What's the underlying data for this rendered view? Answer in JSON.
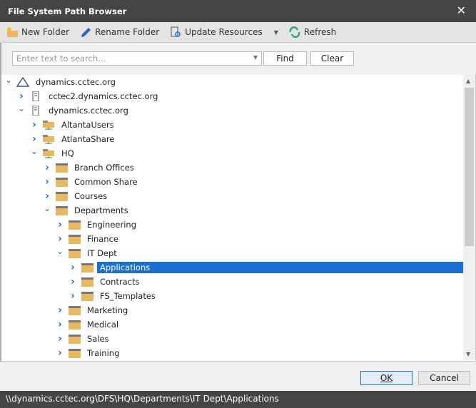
{
  "window": {
    "title": "File System Path Browser"
  },
  "toolbar": {
    "new_folder": "New Folder",
    "rename_folder": "Rename Folder",
    "update_resources": "Update Resources",
    "refresh": "Refresh"
  },
  "search": {
    "placeholder": "Enter text to search...",
    "find": "Find",
    "clear": "Clear"
  },
  "tree": [
    {
      "label": "dynamics.cctec.org",
      "level": 0,
      "icon": "domain",
      "expanded": true
    },
    {
      "label": "cctec2.dynamics.cctec.org",
      "level": 1,
      "icon": "server",
      "expanded": false
    },
    {
      "label": "dynamics.cctec.org",
      "level": 1,
      "icon": "server",
      "expanded": true
    },
    {
      "label": "AltantaUsers",
      "level": 2,
      "icon": "share",
      "expanded": false
    },
    {
      "label": "AtlantaShare",
      "level": 2,
      "icon": "share",
      "expanded": false
    },
    {
      "label": "HQ",
      "level": 2,
      "icon": "share",
      "expanded": true
    },
    {
      "label": "Branch Offices",
      "level": 3,
      "icon": "folder",
      "expanded": false
    },
    {
      "label": "Common Share",
      "level": 3,
      "icon": "folder",
      "expanded": false
    },
    {
      "label": "Courses",
      "level": 3,
      "icon": "folder",
      "expanded": false
    },
    {
      "label": "Departments",
      "level": 3,
      "icon": "folder",
      "expanded": true
    },
    {
      "label": "Engineering",
      "level": 4,
      "icon": "folder",
      "expanded": false
    },
    {
      "label": "Finance",
      "level": 4,
      "icon": "folder",
      "expanded": false
    },
    {
      "label": "IT Dept",
      "level": 4,
      "icon": "folder",
      "expanded": true
    },
    {
      "label": "Applications",
      "level": 5,
      "icon": "folder",
      "expanded": false,
      "selected": true
    },
    {
      "label": "Contracts",
      "level": 5,
      "icon": "folder",
      "expanded": false
    },
    {
      "label": "FS_Templates",
      "level": 5,
      "icon": "folder",
      "expanded": false
    },
    {
      "label": "Marketing",
      "level": 4,
      "icon": "folder",
      "expanded": false
    },
    {
      "label": "Medical",
      "level": 4,
      "icon": "folder",
      "expanded": false
    },
    {
      "label": "Sales",
      "level": 4,
      "icon": "folder",
      "expanded": false
    },
    {
      "label": "Training",
      "level": 4,
      "icon": "folder",
      "expanded": false
    }
  ],
  "footer": {
    "ok": "OK",
    "cancel": "Cancel"
  },
  "status": {
    "path": "\\\\dynamics.cctec.org\\DFS\\HQ\\Departments\\IT Dept\\Applications"
  },
  "colors": {
    "accent": "#1a6fd0",
    "titlebar": "#454545",
    "folder": "#e8b865"
  }
}
